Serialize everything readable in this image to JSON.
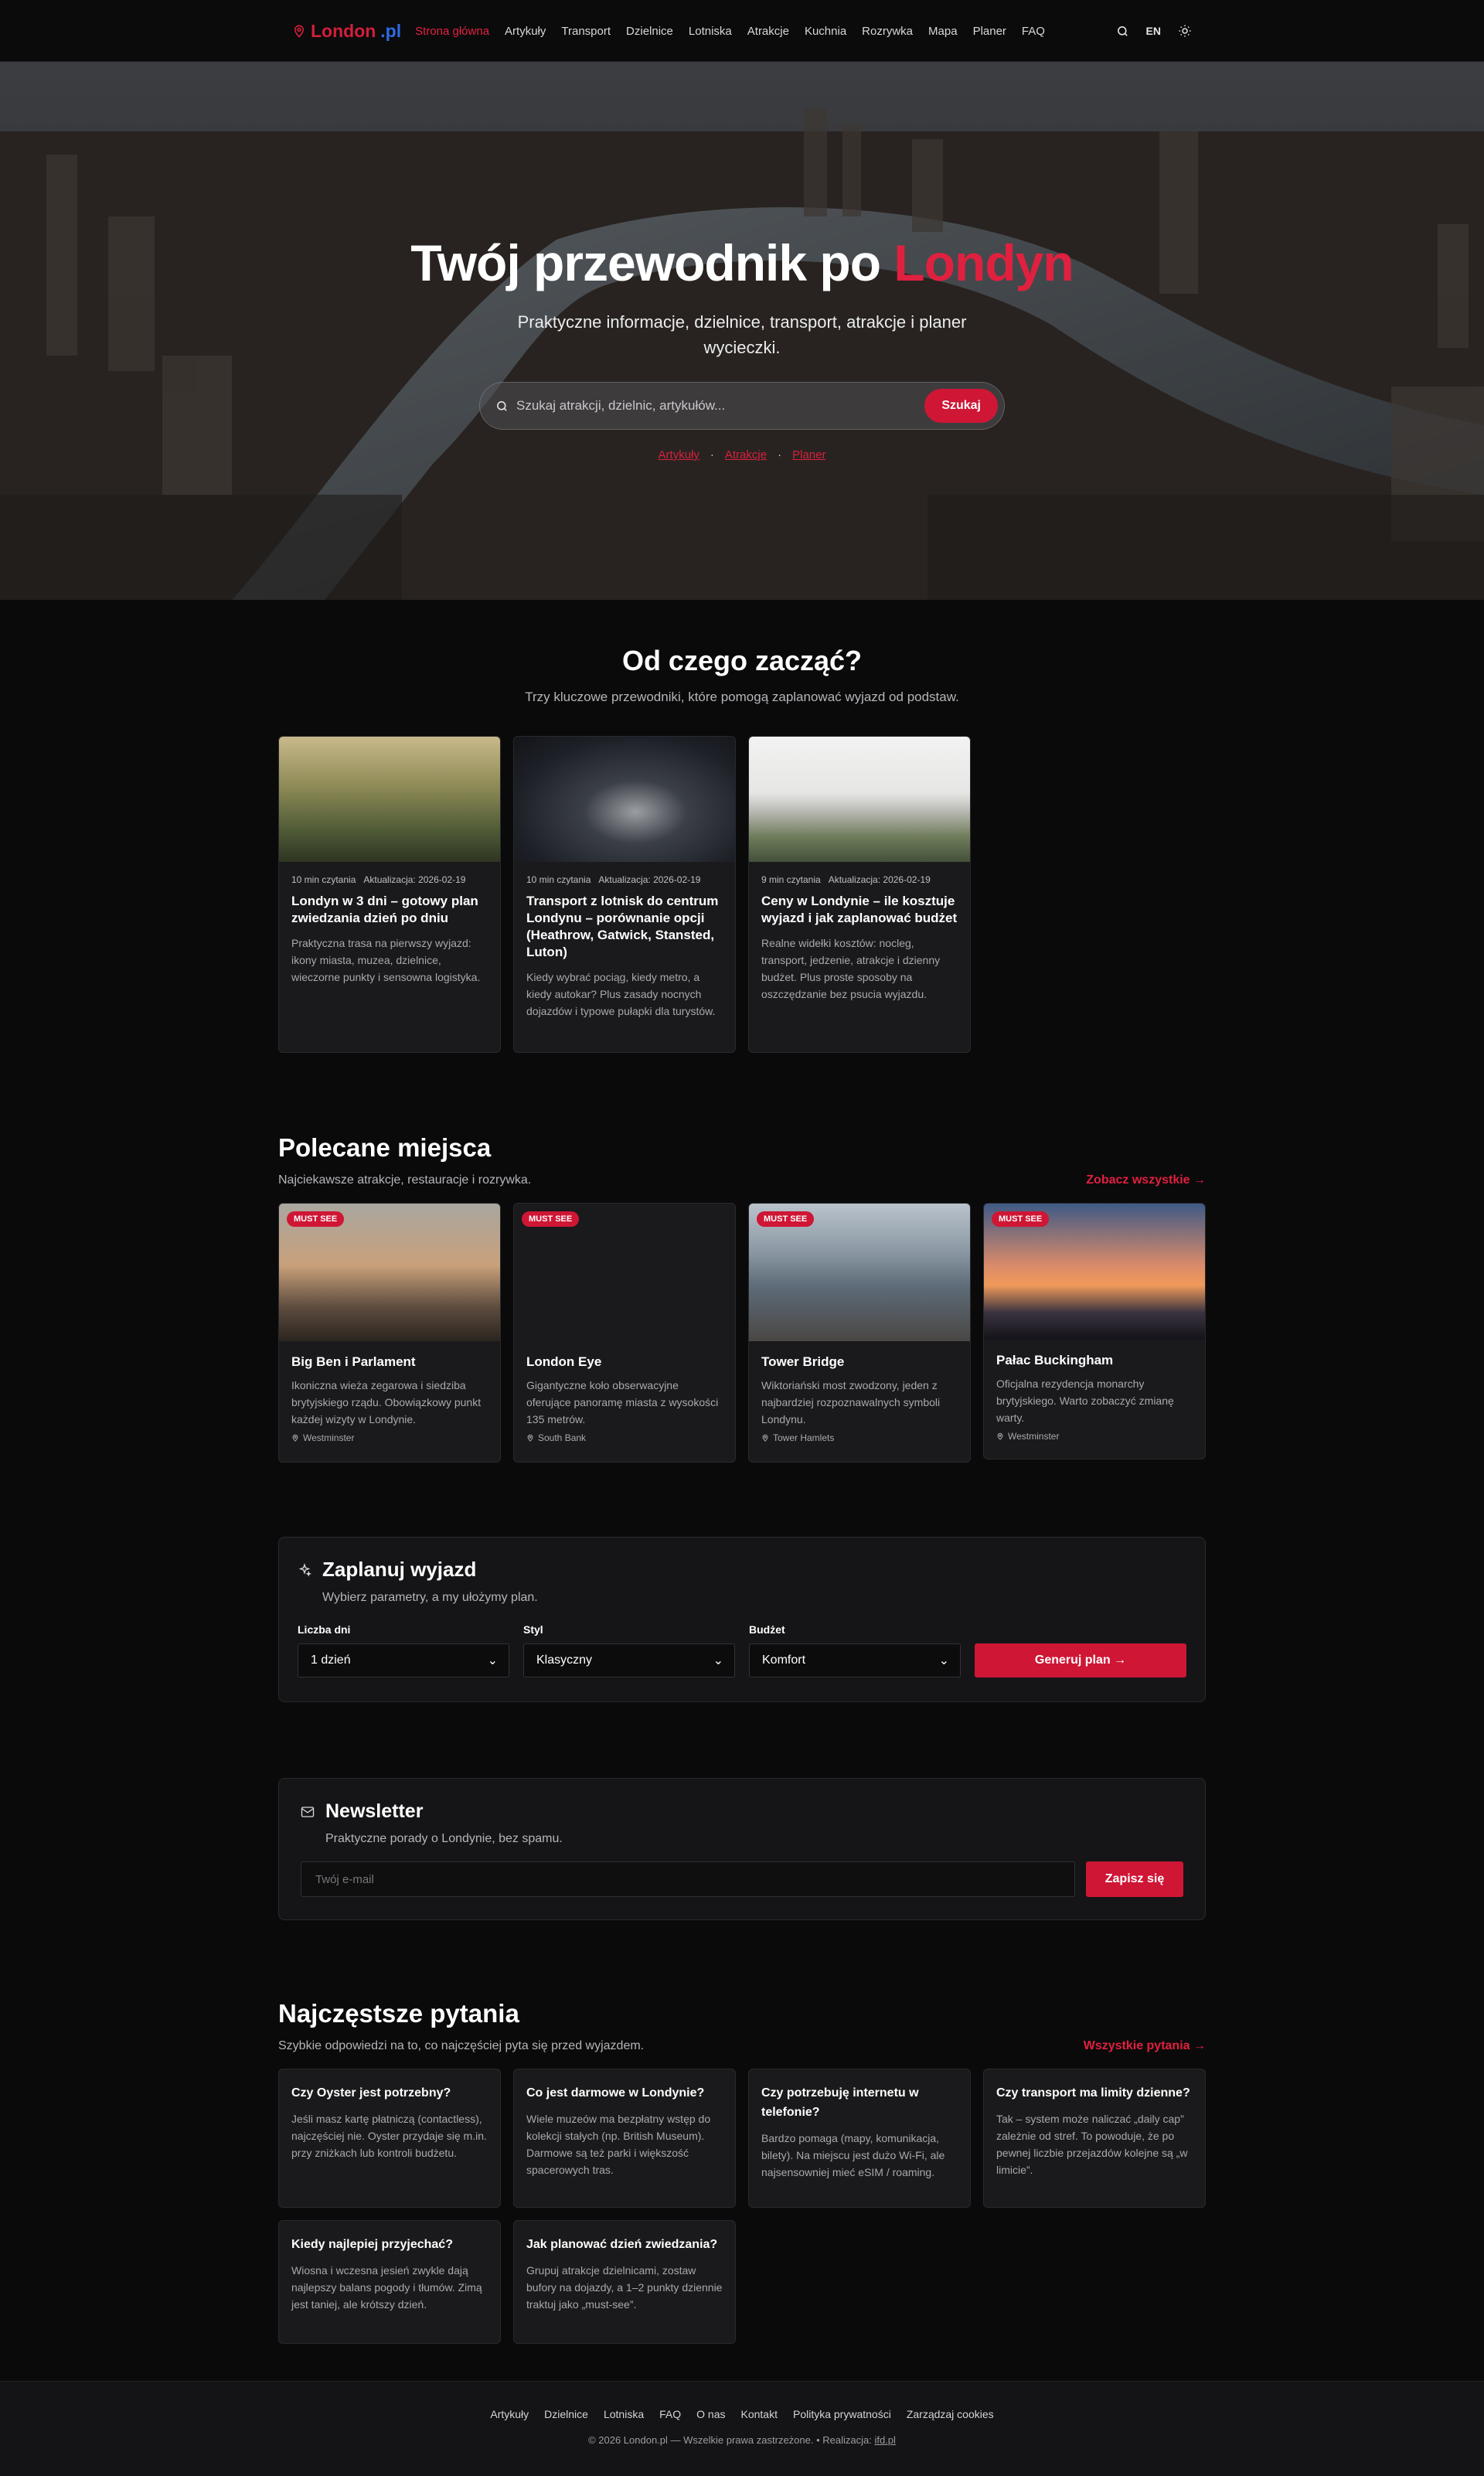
{
  "nav": {
    "brand_1": "London",
    "brand_2": ".pl",
    "items": [
      "Strona główna",
      "Artykuły",
      "Transport",
      "Dzielnice",
      "Lotniska",
      "Atrakcje",
      "Kuchnia",
      "Rozrywka",
      "Mapa",
      "Planer",
      "FAQ"
    ],
    "lang": "EN"
  },
  "hero": {
    "title_main": "Twój przewodnik po ",
    "title_accent": "Londyn",
    "subtitle": "Praktyczne informacje, dzielnice, transport, atrakcje i planer wycieczki.",
    "search_placeholder": "Szukaj atrakcji, dzielnic, artykułów...",
    "search_button": "Szukaj",
    "links": [
      "Artykuły",
      "Atrakcje",
      "Planer"
    ]
  },
  "start": {
    "title": "Od czego zacząć?",
    "subtitle": "Trzy kluczowe przewodniki, które pomogą zaplanować wyjazd od podstaw.",
    "cards": [
      {
        "read": "10 min czytania",
        "updated": "Aktualizacja: 2026-02-19",
        "title": "Londyn w 3 dni – gotowy plan zwiedzania dzień po dniu",
        "desc": "Praktyczna trasa na pierwszy wyjazd: ikony miasta, muzea, dzielnice, wieczorne punkty i sensowna logistyka."
      },
      {
        "read": "10 min czytania",
        "updated": "Aktualizacja: 2026-02-19",
        "title": "Transport z lotnisk do centrum Londynu – porównanie opcji (Heathrow, Gatwick, Stansted, Luton)",
        "desc": "Kiedy wybrać pociąg, kiedy metro, a kiedy autokar? Plus zasady nocnych dojazdów i typowe pułapki dla turystów."
      },
      {
        "read": "9 min czytania",
        "updated": "Aktualizacja: 2026-02-19",
        "title": "Ceny w Londynie – ile kosztuje wyjazd i jak zaplanować budżet",
        "desc": "Realne widełki kosztów: nocleg, transport, jedzenie, atrakcje i dzienny budżet. Plus proste sposoby na oszczędzanie bez psucia wyjazdu."
      }
    ]
  },
  "places": {
    "title": "Polecane miejsca",
    "subtitle": "Najciekawsze atrakcje, restauracje i rozrywka.",
    "more": "Zobacz wszystkie →",
    "badge": "MUST SEE",
    "items": [
      {
        "title": "Big Ben i Parlament",
        "desc": "Ikoniczna wieża zegarowa i siedziba brytyjskiego rządu. Obowiązkowy punkt każdej wizyty w Londynie.",
        "loc": "Westminster"
      },
      {
        "title": "London Eye",
        "desc": "Gigantyczne koło obserwacyjne oferujące panoramę miasta z wysokości 135 metrów.",
        "loc": "South Bank"
      },
      {
        "title": "Tower Bridge",
        "desc": "Wiktoriański most zwodzony, jeden z najbardziej rozpoznawalnych symboli Londynu.",
        "loc": "Tower Hamlets"
      },
      {
        "title": "Pałac Buckingham",
        "desc": "Oficjalna rezydencja monarchy brytyjskiego. Warto zobaczyć zmianę warty.",
        "loc": "Westminster"
      }
    ]
  },
  "planner": {
    "title": "Zaplanuj wyjazd",
    "subtitle": "Wybierz parametry, a my ułożymy plan.",
    "fields": [
      {
        "label": "Liczba dni",
        "value": "1 dzień"
      },
      {
        "label": "Styl",
        "value": "Klasyczny"
      },
      {
        "label": "Budżet",
        "value": "Komfort"
      }
    ],
    "button": "Generuj plan →"
  },
  "newsletter": {
    "title": "Newsletter",
    "subtitle": "Praktyczne porady o Londynie, bez spamu.",
    "placeholder": "Twój e-mail",
    "button": "Zapisz się"
  },
  "faq": {
    "title": "Najczęstsze pytania",
    "subtitle": "Szybkie odpowiedzi na to, co najczęściej pyta się przed wyjazdem.",
    "more": "Wszystkie pytania →",
    "items": [
      {
        "q": "Czy Oyster jest potrzebny?",
        "a": "Jeśli masz kartę płatniczą (contactless), najczęściej nie. Oyster przydaje się m.in. przy zniżkach lub kontroli budżetu."
      },
      {
        "q": "Co jest darmowe w Londynie?",
        "a": "Wiele muzeów ma bezpłatny wstęp do kolekcji stałych (np. British Museum). Darmowe są też parki i większość spacerowych tras."
      },
      {
        "q": "Czy potrzebuję internetu w telefonie?",
        "a": "Bardzo pomaga (mapy, komunikacja, bilety). Na miejscu jest dużo Wi-Fi, ale najsensowniej mieć eSIM / roaming."
      },
      {
        "q": "Czy transport ma limity dzienne?",
        "a": "Tak – system może naliczać „daily cap” zależnie od stref. To powoduje, że po pewnej liczbie przejazdów kolejne są „w limicie”."
      },
      {
        "q": "Kiedy najlepiej przyjechać?",
        "a": "Wiosna i wczesna jesień zwykle dają najlepszy balans pogody i tłumów. Zimą jest taniej, ale krótszy dzień."
      },
      {
        "q": "Jak planować dzień zwiedzania?",
        "a": "Grupuj atrakcje dzielnicami, zostaw bufory na dojazdy, a 1–2 punkty dziennie traktuj jako „must-see”."
      }
    ]
  },
  "footer": {
    "links": [
      "Artykuły",
      "Dzielnice",
      "Lotniska",
      "FAQ",
      "O nas",
      "Kontakt",
      "Polityka prywatności",
      "Zarządzaj cookies"
    ],
    "copy": "© 2026 London.pl — Wszelkie prawa zastrzeżone. • Realizacja: ",
    "credit": "ifd.pl"
  },
  "colors": {
    "accent": "#cf1635",
    "brand_blue": "#2f6ae4",
    "bg": "#0a0a0b",
    "card": "#1a1a1c"
  }
}
